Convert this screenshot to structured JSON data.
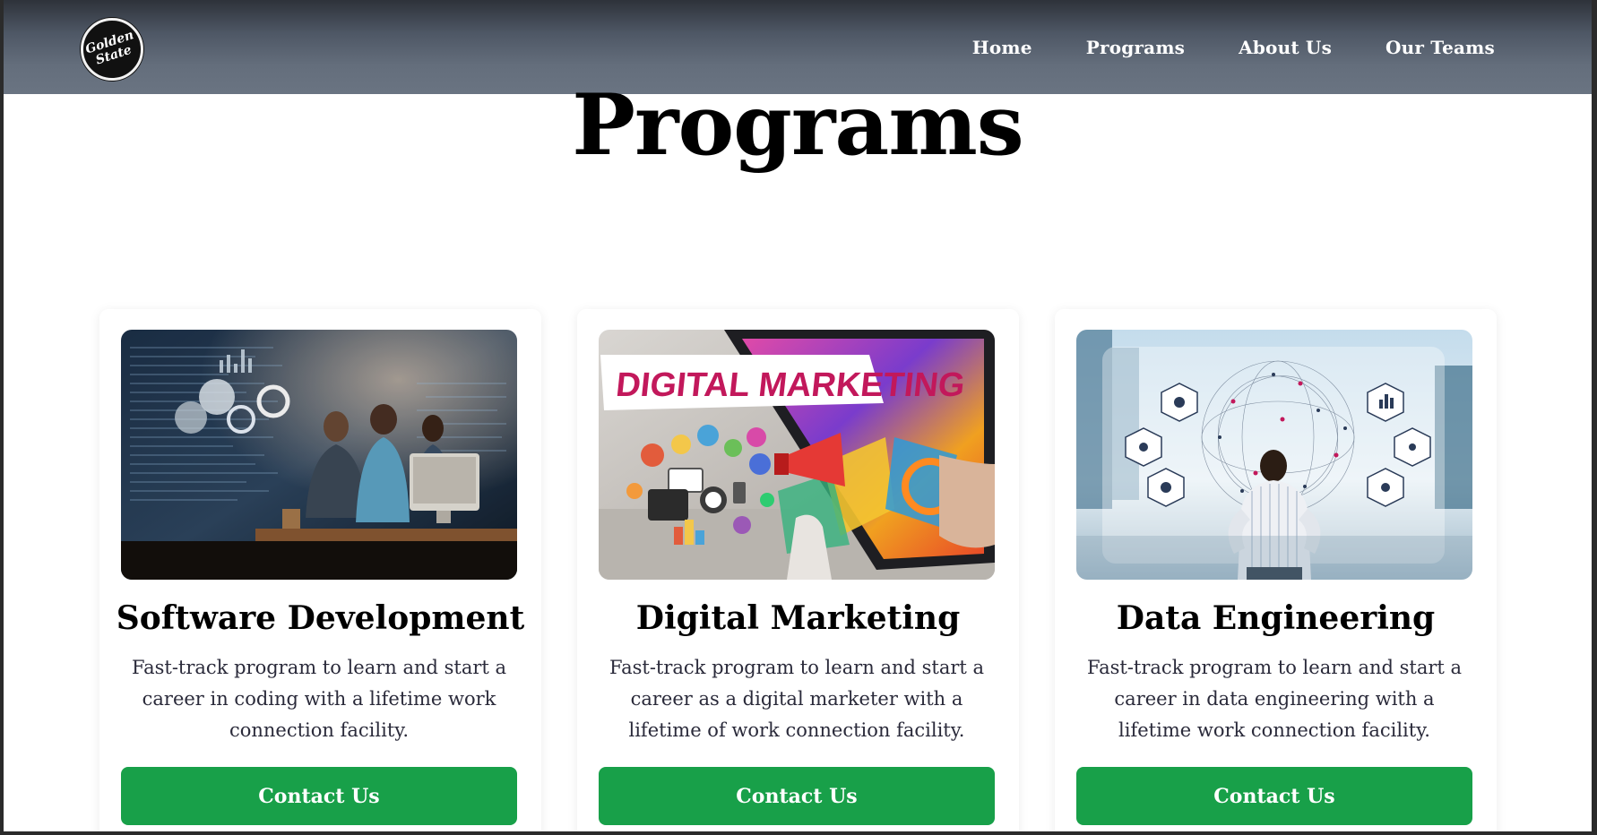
{
  "nav": {
    "logo_text_line1": "Golden",
    "logo_text_line2": "State",
    "links": [
      "Home",
      "Programs",
      "About Us",
      "Our Teams"
    ]
  },
  "page": {
    "title": "Programs"
  },
  "cards": [
    {
      "title": "Software Development",
      "description": "Fast-track program to learn and start a career in coding with a lifetime work connection facility.",
      "button": "Contact Us",
      "image_alt": "team coding at night in front of screens"
    },
    {
      "title": "Digital Marketing",
      "description": "Fast-track program to learn and start a career as a digital marketer with a lifetime of work connection facility.",
      "button": "Contact Us",
      "image_banner_text": "DIGITAL MARKETING"
    },
    {
      "title": "Data Engineering",
      "description": "Fast-track program to learn and start a career in data engineering with a lifetime work connection facility.",
      "button": "Contact Us",
      "image_alt": "man looking at data network visualization"
    }
  ],
  "colors": {
    "button_green": "#18a049",
    "nav_bg": "#5d6674",
    "text_dark": "#000000"
  },
  "icons": [
    "golden-state-logo-icon"
  ]
}
